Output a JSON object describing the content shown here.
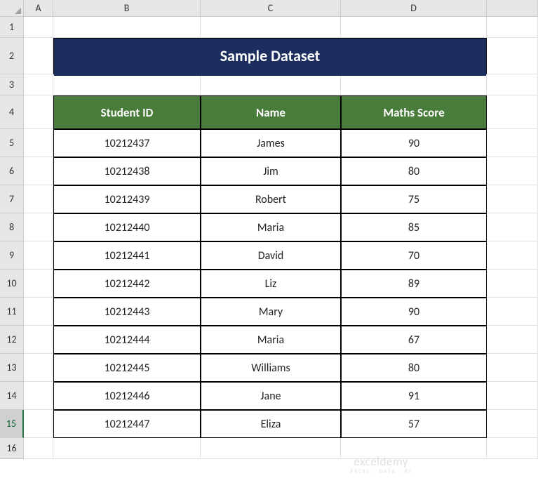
{
  "columns": [
    "A",
    "B",
    "C",
    "D"
  ],
  "row_numbers": [
    "1",
    "2",
    "3",
    "4",
    "5",
    "6",
    "7",
    "8",
    "9",
    "10",
    "11",
    "12",
    "13",
    "14",
    "15",
    "16"
  ],
  "title": "Sample Dataset",
  "headers": [
    "Student ID",
    "Name",
    "Maths Score"
  ],
  "rows": [
    {
      "id": "10212437",
      "name": "James",
      "score": "90"
    },
    {
      "id": "10212438",
      "name": "Jim",
      "score": "80"
    },
    {
      "id": "10212439",
      "name": "Robert",
      "score": "75"
    },
    {
      "id": "10212440",
      "name": "Maria",
      "score": "85"
    },
    {
      "id": "10212441",
      "name": "David",
      "score": "70"
    },
    {
      "id": "10212442",
      "name": "Liz",
      "score": "89"
    },
    {
      "id": "10212443",
      "name": "Mary",
      "score": "90"
    },
    {
      "id": "10212444",
      "name": "Maria",
      "score": "67"
    },
    {
      "id": "10212445",
      "name": "Williams",
      "score": "80"
    },
    {
      "id": "10212446",
      "name": "Jane",
      "score": "91"
    },
    {
      "id": "10212447",
      "name": "Eliza",
      "score": "57"
    }
  ],
  "selected_row": "15",
  "watermark": {
    "line1": "exceldemy",
    "line2": "EXCEL · DATA · BI"
  },
  "chart_data": {
    "type": "table",
    "title": "Sample Dataset",
    "columns": [
      "Student ID",
      "Name",
      "Maths Score"
    ],
    "data": [
      [
        "10212437",
        "James",
        90
      ],
      [
        "10212438",
        "Jim",
        80
      ],
      [
        "10212439",
        "Robert",
        75
      ],
      [
        "10212440",
        "Maria",
        85
      ],
      [
        "10212441",
        "David",
        70
      ],
      [
        "10212442",
        "Liz",
        89
      ],
      [
        "10212443",
        "Mary",
        90
      ],
      [
        "10212444",
        "Maria",
        67
      ],
      [
        "10212445",
        "Williams",
        80
      ],
      [
        "10212446",
        "Jane",
        91
      ],
      [
        "10212447",
        "Eliza",
        57
      ]
    ]
  }
}
